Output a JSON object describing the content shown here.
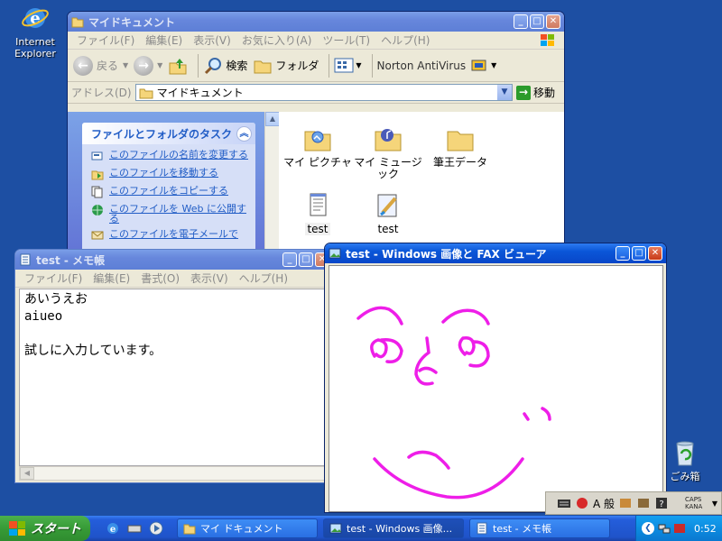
{
  "desktop": {
    "icons": [
      {
        "label": "Internet Explorer"
      },
      {
        "label": "ごみ箱"
      }
    ]
  },
  "explorer": {
    "title": "マイドキュメント",
    "menu": [
      "ファイル(F)",
      "編集(E)",
      "表示(V)",
      "お気に入り(A)",
      "ツール(T)",
      "ヘルプ(H)"
    ],
    "toolbar": {
      "back": "戻る",
      "search": "検索",
      "folders": "フォルダ",
      "norton": "Norton AntiVirus"
    },
    "address": {
      "label": "アドレス(D)",
      "value": "マイドキュメント",
      "go": "移動"
    },
    "taskpane": {
      "heading": "ファイルとフォルダのタスク",
      "items": [
        "このファイルの名前を変更する",
        "このファイルを移動する",
        "このファイルをコピーする",
        "このファイルを Web に公開する",
        "このファイルを電子メールで"
      ]
    },
    "files": [
      {
        "name": "マイ ピクチャ"
      },
      {
        "name": "マイ ミュージック"
      },
      {
        "name": "筆王データ"
      },
      {
        "name": "test"
      },
      {
        "name": "test"
      }
    ]
  },
  "notepad": {
    "title": "test - メモ帳",
    "menu": [
      "ファイル(F)",
      "編集(E)",
      "書式(O)",
      "表示(V)",
      "ヘルプ(H)"
    ],
    "content": "あいうえお\naiueo\n\n試しに入力しています。"
  },
  "viewer": {
    "title": "test - Windows 画像と FAX ビューア"
  },
  "taskbar": {
    "start": "スタート",
    "buttons": [
      {
        "label": "マイ ドキュメント"
      },
      {
        "label": "test - Windows 画像..."
      },
      {
        "label": "test - メモ帳"
      }
    ],
    "clock": "0:52"
  },
  "ime": {
    "mode": "A 般",
    "caps": "CAPS",
    "kana": "KANA"
  },
  "colors": {
    "desktop": "#1d4fa3",
    "drawing": "#ee1ee8"
  }
}
